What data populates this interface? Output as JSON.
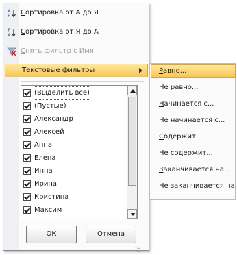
{
  "menu": {
    "sort_asc": {
      "k": "С",
      "rest": "ортировка от А до Я"
    },
    "sort_desc": {
      "k": "С",
      "rest": "ортировка от Я до А"
    },
    "clear_filter": {
      "k": "С",
      "rest": "нять фильтр с Имя"
    },
    "text_filters": {
      "k": "Т",
      "rest": "екстовые фильтры"
    }
  },
  "list": {
    "items": [
      {
        "label": "(Выделить все)",
        "checked": true
      },
      {
        "label": "(Пустые)",
        "checked": true
      },
      {
        "label": "Александр",
        "checked": true
      },
      {
        "label": "Алексей",
        "checked": true
      },
      {
        "label": "Анна",
        "checked": true
      },
      {
        "label": "Елена",
        "checked": true
      },
      {
        "label": "Инна",
        "checked": true
      },
      {
        "label": "Ирина",
        "checked": true
      },
      {
        "label": "Кристина",
        "checked": true
      },
      {
        "label": "Максим",
        "checked": true
      }
    ]
  },
  "buttons": {
    "ok": "ОК",
    "cancel": "Отмена"
  },
  "submenu": {
    "items": [
      {
        "k": "Р",
        "rest": "авно..."
      },
      {
        "k": "Н",
        "rest": "е равно..."
      },
      {
        "k": "Н",
        "rest": "ачинается с..."
      },
      {
        "k": "Н",
        "rest": "е начинается с..."
      },
      {
        "k": "С",
        "rest": "одержит..."
      },
      {
        "k": "Н",
        "rest": "е содержит..."
      },
      {
        "k": "З",
        "rest": "аканчивается на..."
      },
      {
        "k": "Н",
        "rest": "е заканчивается на..."
      }
    ]
  },
  "icons": {
    "sort_asc": "sort-az-icon",
    "sort_desc": "sort-za-icon",
    "clear_filter": "clear-filter-icon",
    "submenu_arrow": "chevron-right-icon"
  },
  "colors": {
    "highlight": "#f8c650",
    "menu_border": "#8c8c8c",
    "gutter": "#eef0f4"
  }
}
